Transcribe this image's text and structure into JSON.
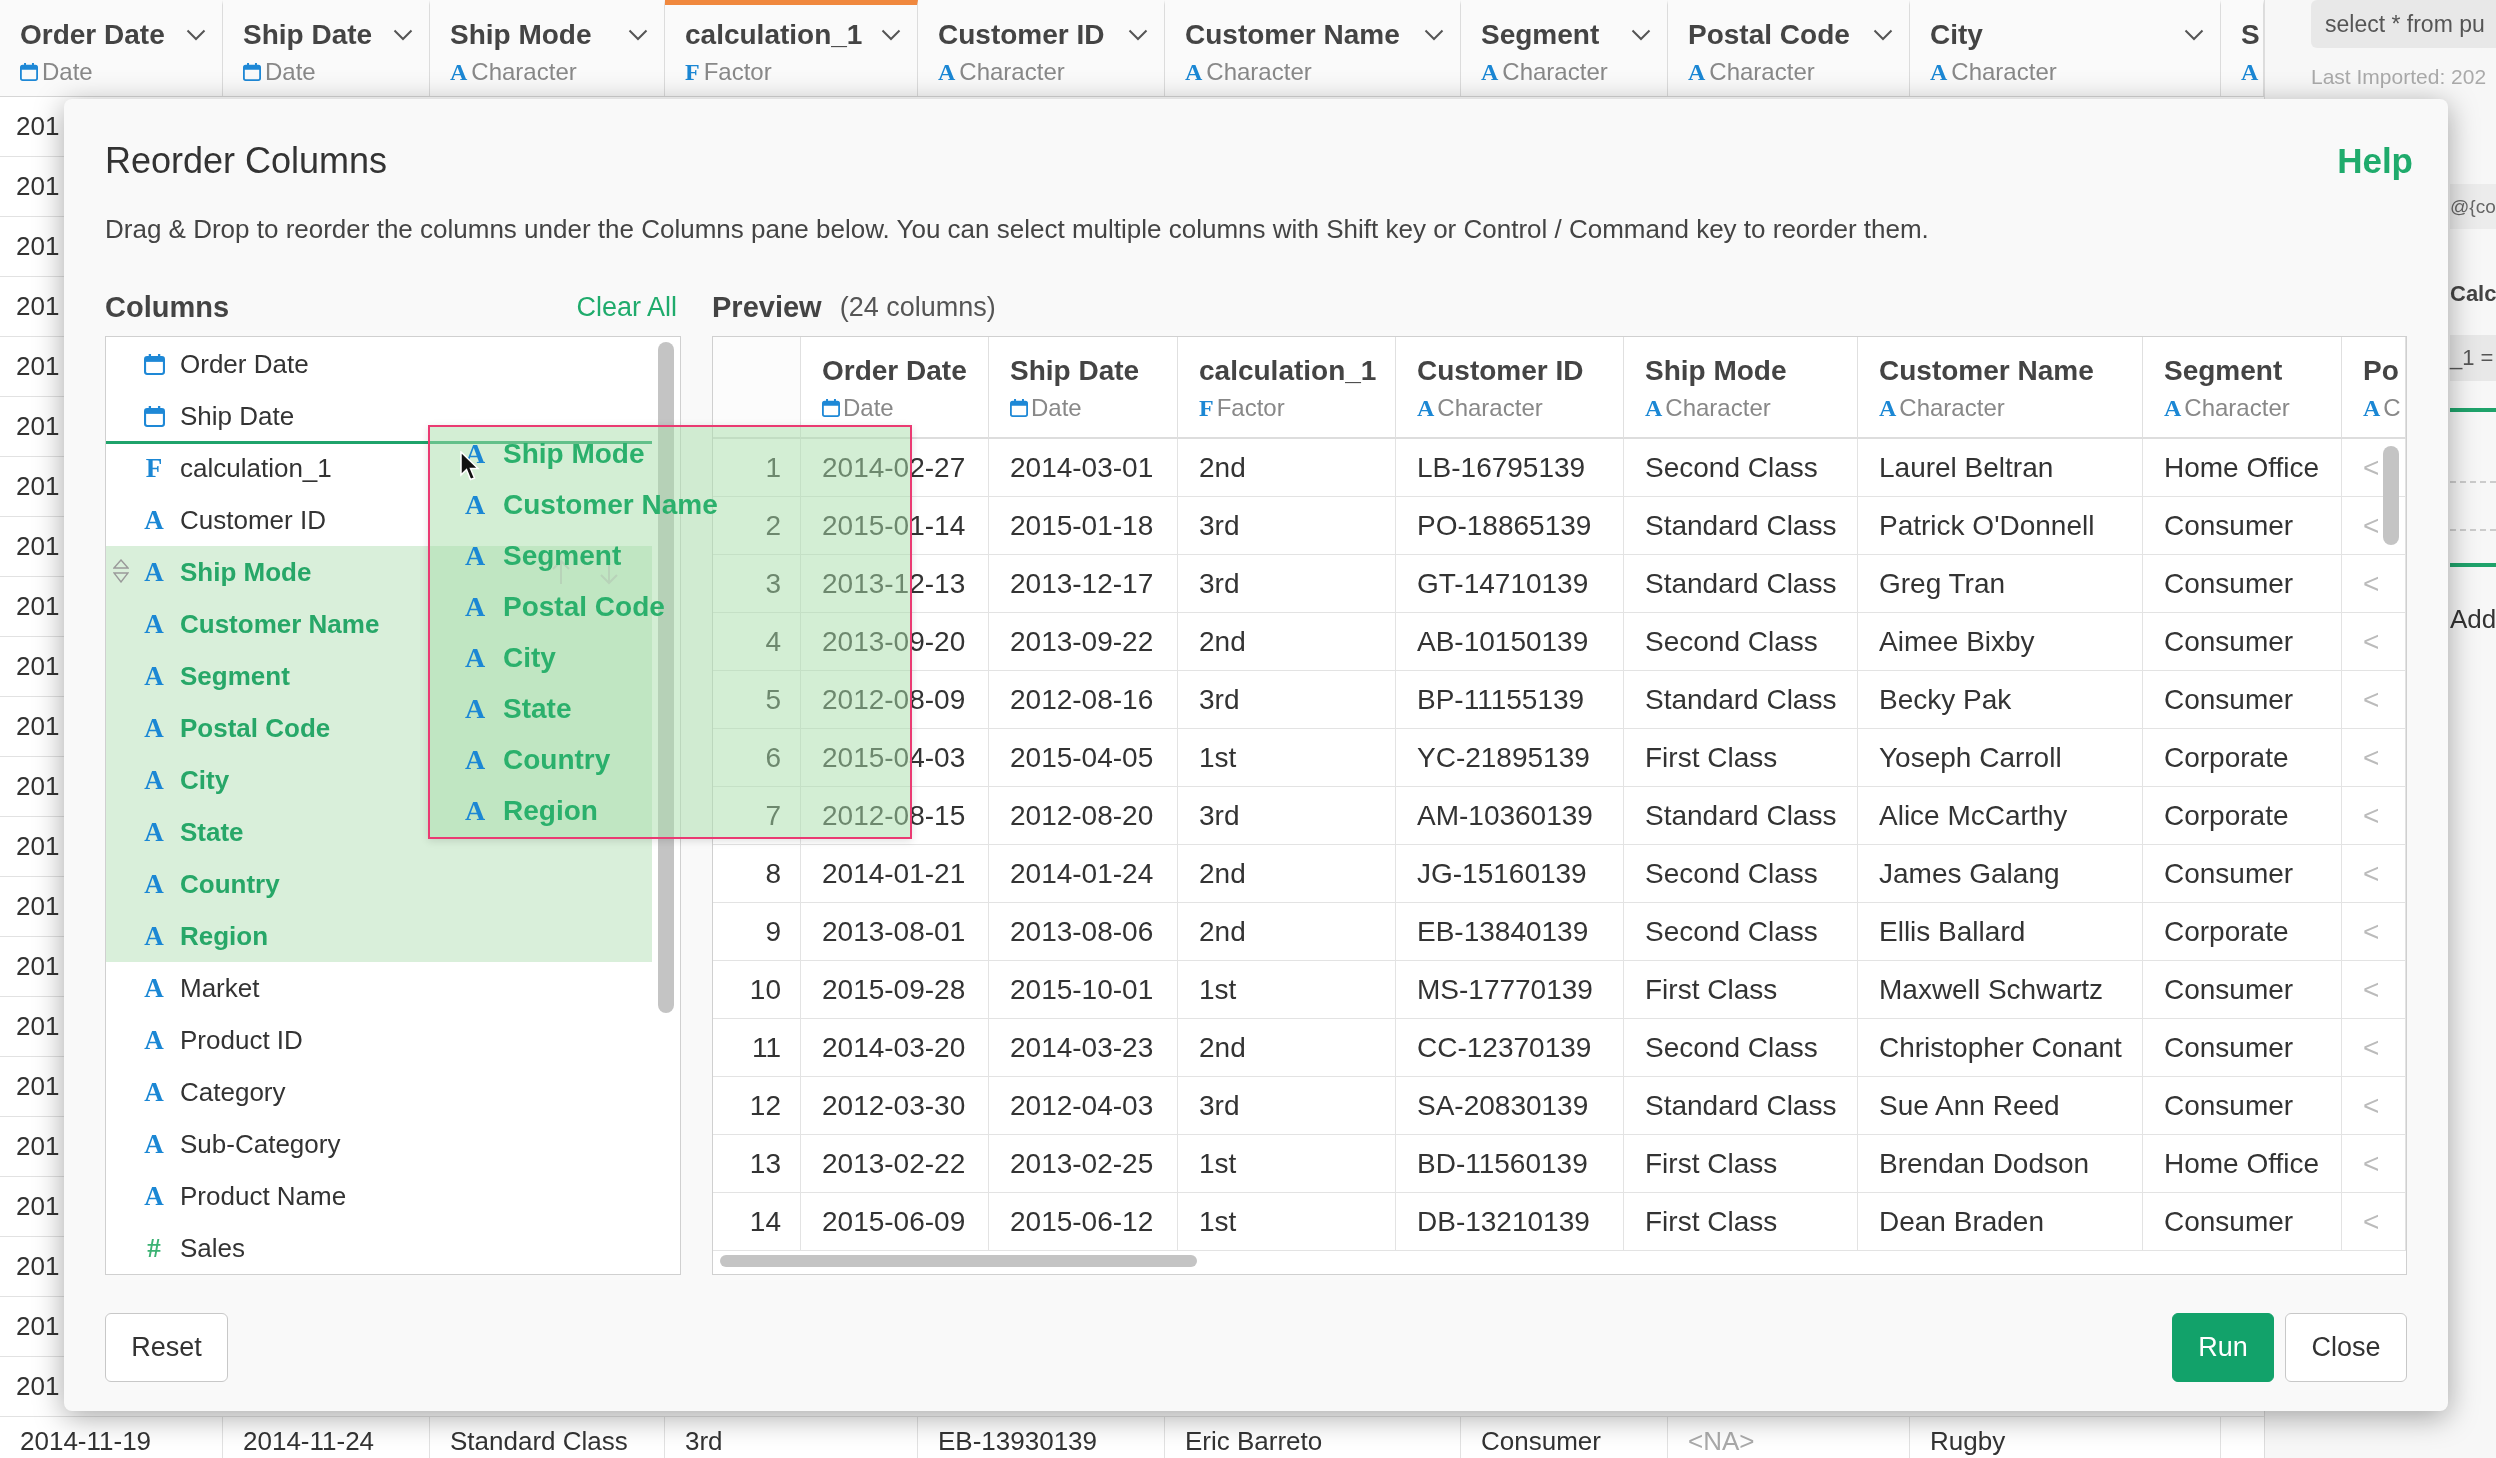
{
  "data_grid": {
    "columns": [
      {
        "label": "Order Date",
        "kind": "date",
        "type": "Date",
        "selected": false,
        "caret": true
      },
      {
        "label": "Ship Date",
        "kind": "date",
        "type": "Date",
        "selected": false,
        "caret": true
      },
      {
        "label": "Ship Mode",
        "kind": "character",
        "icon": "A",
        "type": "Character",
        "selected": false,
        "caret": true
      },
      {
        "label": "calculation_1",
        "kind": "factor",
        "icon": "F",
        "type": "Factor",
        "selected": true,
        "caret": true
      },
      {
        "label": "Customer ID",
        "kind": "character",
        "icon": "A",
        "type": "Character",
        "selected": false,
        "caret": true
      },
      {
        "label": "Customer Name",
        "kind": "character",
        "icon": "A",
        "type": "Character",
        "selected": false,
        "caret": true
      },
      {
        "label": "Segment",
        "kind": "character",
        "icon": "A",
        "type": "Character",
        "selected": false,
        "caret": true
      },
      {
        "label": "Postal Code",
        "kind": "character",
        "icon": "A",
        "type": "Character",
        "selected": false,
        "caret": true
      },
      {
        "label": "City",
        "kind": "character",
        "icon": "A",
        "type": "Character",
        "selected": false,
        "caret": true
      },
      {
        "label": "S",
        "kind": "character",
        "icon": "A",
        "selected": false,
        "caret": false
      }
    ],
    "row_fragments": [
      "201",
      "201",
      "201",
      "201",
      "201",
      "201",
      "201",
      "201",
      "201",
      "201",
      "201",
      "201",
      "201",
      "201",
      "201",
      "201",
      "201",
      "201",
      "201",
      "201",
      "201",
      "201"
    ],
    "last_row": [
      {
        "text": "2014-11-19",
        "missing": false
      },
      {
        "text": "2014-11-24",
        "missing": false
      },
      {
        "text": "Standard Class",
        "missing": false
      },
      {
        "text": "3rd",
        "missing": false
      },
      {
        "text": "EB-13930139",
        "missing": false
      },
      {
        "text": "Eric Barreto",
        "missing": false
      },
      {
        "text": "Consumer",
        "missing": false
      },
      {
        "text": "<NA>",
        "missing": true
      },
      {
        "text": "Rugby",
        "missing": false
      }
    ]
  },
  "side_panel": {
    "query": "select * from pu",
    "last_imported": "Last Imported: 202",
    "expression": "@{co",
    "section_title": "Calc",
    "formula": "_1 =",
    "add": "Add"
  },
  "dialog": {
    "title": "Reorder Columns",
    "help": "Help",
    "description": "Drag & Drop to reorder the columns under the Columns pane below. You can select multiple columns with Shift key or Control / Command key to reorder them.",
    "columns_pane": {
      "title": "Columns",
      "clear_all": "Clear All",
      "items": [
        {
          "label": "Order Date",
          "kind": "date",
          "selected": false,
          "hovered": false,
          "drop_line_below": false
        },
        {
          "label": "Ship Date",
          "kind": "date",
          "selected": false,
          "hovered": false,
          "drop_line_below": true
        },
        {
          "label": "calculation_1",
          "kind": "factor",
          "icon": "F",
          "selected": false,
          "hovered": false,
          "drop_line_below": false
        },
        {
          "label": "Customer ID",
          "kind": "character",
          "icon": "A",
          "selected": false,
          "hovered": false,
          "drop_line_below": false
        },
        {
          "label": "Ship Mode",
          "kind": "character",
          "icon": "A",
          "selected": true,
          "hovered": true,
          "drop_line_below": false
        },
        {
          "label": "Customer Name",
          "kind": "character",
          "icon": "A",
          "selected": true,
          "hovered": false,
          "drop_line_below": false
        },
        {
          "label": "Segment",
          "kind": "character",
          "icon": "A",
          "selected": true,
          "hovered": false,
          "drop_line_below": false
        },
        {
          "label": "Postal Code",
          "kind": "character",
          "icon": "A",
          "selected": true,
          "hovered": false,
          "drop_line_below": false
        },
        {
          "label": "City",
          "kind": "character",
          "icon": "A",
          "selected": true,
          "hovered": false,
          "drop_line_below": false
        },
        {
          "label": "State",
          "kind": "character",
          "icon": "A",
          "selected": true,
          "hovered": false,
          "drop_line_below": false
        },
        {
          "label": "Country",
          "kind": "character",
          "icon": "A",
          "selected": true,
          "hovered": false,
          "drop_line_below": false
        },
        {
          "label": "Region",
          "kind": "character",
          "icon": "A",
          "selected": true,
          "hovered": false,
          "drop_line_below": false
        },
        {
          "label": "Market",
          "kind": "character",
          "icon": "A",
          "selected": false,
          "hovered": false,
          "drop_line_below": false
        },
        {
          "label": "Product ID",
          "kind": "character",
          "icon": "A",
          "selected": false,
          "hovered": false,
          "drop_line_below": false
        },
        {
          "label": "Category",
          "kind": "character",
          "icon": "A",
          "selected": false,
          "hovered": false,
          "drop_line_below": false
        },
        {
          "label": "Sub-Category",
          "kind": "character",
          "icon": "A",
          "selected": false,
          "hovered": false,
          "drop_line_below": false
        },
        {
          "label": "Product Name",
          "kind": "character",
          "icon": "A",
          "selected": false,
          "hovered": false,
          "drop_line_below": false
        },
        {
          "label": "Sales",
          "kind": "numeric",
          "icon": "#",
          "selected": false,
          "hovered": false,
          "drop_line_below": false
        }
      ]
    },
    "drag_preview": {
      "items": [
        {
          "label": "Ship Mode",
          "kind": "character",
          "icon": "A"
        },
        {
          "label": "Customer Name",
          "kind": "character",
          "icon": "A"
        },
        {
          "label": "Segment",
          "kind": "character",
          "icon": "A"
        },
        {
          "label": "Postal Code",
          "kind": "character",
          "icon": "A"
        },
        {
          "label": "City",
          "kind": "character",
          "icon": "A"
        },
        {
          "label": "State",
          "kind": "character",
          "icon": "A"
        },
        {
          "label": "Country",
          "kind": "character",
          "icon": "A"
        },
        {
          "label": "Region",
          "kind": "character",
          "icon": "A"
        }
      ]
    },
    "preview": {
      "title": "Preview",
      "count": "(24 columns)",
      "columns": [
        {
          "label": "Order Date",
          "kind": "date",
          "type": "Date",
          "missing_values": false
        },
        {
          "label": "Ship Date",
          "kind": "date",
          "type": "Date",
          "missing_values": false
        },
        {
          "label": "calculation_1",
          "kind": "factor",
          "icon": "F",
          "type": "Factor",
          "missing_values": false
        },
        {
          "label": "Customer ID",
          "kind": "character",
          "icon": "A",
          "type": "Character",
          "missing_values": false
        },
        {
          "label": "Ship Mode",
          "kind": "character",
          "icon": "A",
          "type": "Character",
          "missing_values": false
        },
        {
          "label": "Customer Name",
          "kind": "character",
          "icon": "A",
          "type": "Character",
          "missing_values": false
        },
        {
          "label": "Segment",
          "kind": "character",
          "icon": "A",
          "type": "Character",
          "missing_values": false
        },
        {
          "label": "Po",
          "kind": "character",
          "icon": "A",
          "type": "C",
          "missing_values": true
        }
      ],
      "rows": [
        {
          "number": "1",
          "cells": [
            "2014-02-27",
            "2014-03-01",
            "2nd",
            "LB-16795139",
            "Second Class",
            "Laurel Beltran",
            "Home Office",
            "<"
          ]
        },
        {
          "number": "2",
          "cells": [
            "2015-01-14",
            "2015-01-18",
            "3rd",
            "PO-18865139",
            "Standard Class",
            "Patrick O'Donnell",
            "Consumer",
            "<"
          ]
        },
        {
          "number": "3",
          "cells": [
            "2013-12-13",
            "2013-12-17",
            "3rd",
            "GT-14710139",
            "Standard Class",
            "Greg Tran",
            "Consumer",
            "<"
          ]
        },
        {
          "number": "4",
          "cells": [
            "2013-09-20",
            "2013-09-22",
            "2nd",
            "AB-10150139",
            "Second Class",
            "Aimee Bixby",
            "Consumer",
            "<"
          ]
        },
        {
          "number": "5",
          "cells": [
            "2012-08-09",
            "2012-08-16",
            "3rd",
            "BP-11155139",
            "Standard Class",
            "Becky Pak",
            "Consumer",
            "<"
          ]
        },
        {
          "number": "6",
          "cells": [
            "2015-04-03",
            "2015-04-05",
            "1st",
            "YC-21895139",
            "First Class",
            "Yoseph Carroll",
            "Corporate",
            "<"
          ]
        },
        {
          "number": "7",
          "cells": [
            "2012-08-15",
            "2012-08-20",
            "3rd",
            "AM-10360139",
            "Standard Class",
            "Alice McCarthy",
            "Corporate",
            "<"
          ]
        },
        {
          "number": "8",
          "cells": [
            "2014-01-21",
            "2014-01-24",
            "2nd",
            "JG-15160139",
            "Second Class",
            "James Galang",
            "Consumer",
            "<"
          ]
        },
        {
          "number": "9",
          "cells": [
            "2013-08-01",
            "2013-08-06",
            "2nd",
            "EB-13840139",
            "Second Class",
            "Ellis Ballard",
            "Corporate",
            "<"
          ]
        },
        {
          "number": "10",
          "cells": [
            "2015-09-28",
            "2015-10-01",
            "1st",
            "MS-17770139",
            "First Class",
            "Maxwell Schwartz",
            "Consumer",
            "<"
          ]
        },
        {
          "number": "11",
          "cells": [
            "2014-03-20",
            "2014-03-23",
            "2nd",
            "CC-12370139",
            "Second Class",
            "Christopher Conant",
            "Consumer",
            "<"
          ]
        },
        {
          "number": "12",
          "cells": [
            "2012-03-30",
            "2012-04-03",
            "3rd",
            "SA-20830139",
            "Standard Class",
            "Sue Ann Reed",
            "Consumer",
            "<"
          ]
        },
        {
          "number": "13",
          "cells": [
            "2013-02-22",
            "2013-02-25",
            "1st",
            "BD-11560139",
            "First Class",
            "Brendan Dodson",
            "Home Office",
            "<"
          ]
        },
        {
          "number": "14",
          "cells": [
            "2015-06-09",
            "2015-06-12",
            "1st",
            "DB-13210139",
            "First Class",
            "Dean Braden",
            "Consumer",
            "<"
          ]
        }
      ]
    },
    "footer": {
      "reset": "Reset",
      "run": "Run",
      "close": "Close"
    }
  }
}
